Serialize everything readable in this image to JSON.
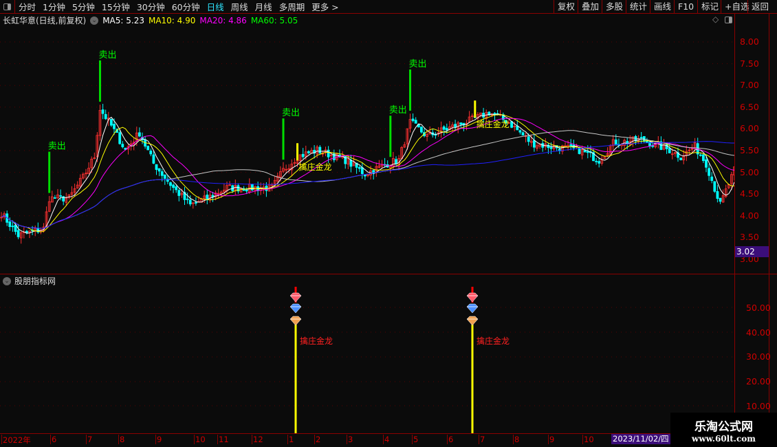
{
  "toolbar": {
    "periods": [
      "分时",
      "1分钟",
      "5分钟",
      "15分钟",
      "30分钟",
      "60分钟",
      "日线",
      "周线",
      "月线",
      "多周期",
      "更多 >"
    ],
    "active": "日线",
    "right": [
      "复权",
      "叠加",
      "多股",
      "统计",
      "画线",
      "F10",
      "标记",
      "+自选",
      "返回"
    ]
  },
  "info": {
    "title": "长虹华意(日线,前复权)",
    "ma5": "MA5: 5.23",
    "ma10": "MA10: 4.90",
    "ma20": "MA20: 4.86",
    "ma60": "MA60: 5.05"
  },
  "colors": {
    "ma5": "#ffffff",
    "ma10": "#ffff00",
    "ma20": "#ff00ff",
    "ma60": "#00ff00",
    "up": "#ff3030",
    "down": "#00ffff",
    "axis": "#d00000",
    "long_ma": "#2020ff"
  },
  "price_axis": {
    "labels": [
      "8.00",
      "7.50",
      "7.00",
      "6.50",
      "6.00",
      "5.50",
      "5.00",
      "4.50",
      "4.00",
      "3.50",
      "3.00"
    ],
    "current": "3.02"
  },
  "indicator": {
    "name": "股朋指标网",
    "axis_labels": [
      "50.00",
      "40.00",
      "30.00",
      "20.00",
      "10.00"
    ],
    "signal_label": "擒庄金龙"
  },
  "chart_data": {
    "type": "candlestick",
    "bars": 261,
    "price_path": [
      [
        0,
        4.05
      ],
      [
        6,
        3.54
      ],
      [
        15,
        3.7
      ],
      [
        17,
        4.4
      ],
      [
        24,
        4.4
      ],
      [
        29,
        4.88
      ],
      [
        33,
        5.36
      ],
      [
        35,
        6.46
      ],
      [
        39,
        6.07
      ],
      [
        44,
        5.51
      ],
      [
        49,
        5.91
      ],
      [
        54,
        5.2
      ],
      [
        61,
        4.64
      ],
      [
        67,
        4.24
      ],
      [
        73,
        4.4
      ],
      [
        80,
        4.64
      ],
      [
        90,
        4.64
      ],
      [
        96,
        4.64
      ],
      [
        100,
        5.04
      ],
      [
        105,
        5.36
      ],
      [
        112,
        5.51
      ],
      [
        122,
        5.28
      ],
      [
        129,
        4.96
      ],
      [
        137,
        5.2
      ],
      [
        141,
        5.28
      ],
      [
        145,
        6.15
      ],
      [
        151,
        5.83
      ],
      [
        161,
        6.07
      ],
      [
        168,
        6.23
      ],
      [
        173,
        6.38
      ],
      [
        180,
        6.15
      ],
      [
        188,
        5.67
      ],
      [
        195,
        5.59
      ],
      [
        205,
        5.51
      ],
      [
        212,
        5.28
      ],
      [
        217,
        5.67
      ],
      [
        227,
        5.75
      ],
      [
        237,
        5.51
      ],
      [
        241,
        5.36
      ],
      [
        246,
        5.59
      ],
      [
        250,
        5.2
      ],
      [
        255,
        4.25
      ],
      [
        260,
        5.04
      ]
    ],
    "sell_signals": [
      {
        "bar": 17,
        "label": "卖出"
      },
      {
        "bar": 35,
        "label": "卖出"
      },
      {
        "bar": 100,
        "label": "卖出"
      },
      {
        "bar": 138,
        "label": "卖出"
      },
      {
        "bar": 145,
        "label": "卖出"
      }
    ],
    "buy_signals": [
      {
        "bar": 105,
        "label": "擒庄金龙"
      },
      {
        "bar": 168,
        "label": "擒庄金龙"
      }
    ],
    "ylim": [
      3.0,
      8.3
    ]
  },
  "time_axis": {
    "labels": [
      "2022年",
      "6",
      "7",
      "8",
      "9",
      "10",
      "11",
      "12",
      "1",
      "2",
      "3",
      "4",
      "5",
      "6",
      "7",
      "8",
      "9",
      "10"
    ],
    "cursor_date": "2023/11/02/四"
  },
  "watermark": {
    "name": "乐淘公式网",
    "url": "www.60lt.com"
  }
}
